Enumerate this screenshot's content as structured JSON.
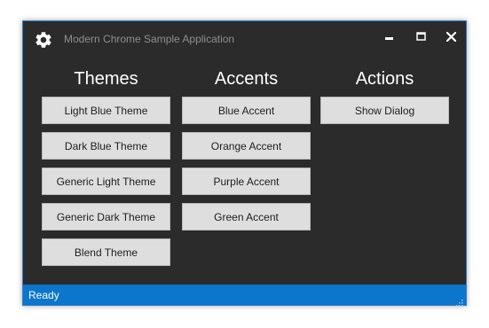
{
  "window": {
    "title": "Modern Chrome Sample Application",
    "icon": "gear-icon",
    "controls": {
      "minimize_icon": "minimize-icon",
      "maximize_icon": "maximize-icon",
      "close_icon": "close-icon"
    }
  },
  "themes": {
    "heading": "Themes",
    "buttons": [
      "Light Blue Theme",
      "Dark Blue Theme",
      "Generic Light Theme",
      "Generic Dark Theme",
      "Blend Theme"
    ]
  },
  "accents": {
    "heading": "Accents",
    "buttons": [
      "Blue Accent",
      "Orange Accent",
      "Purple Accent",
      "Green Accent"
    ]
  },
  "actions": {
    "heading": "Actions",
    "buttons": [
      "Show Dialog"
    ]
  },
  "statusbar": {
    "text": "Ready",
    "grip_icon": "resize-grip-icon"
  },
  "colors": {
    "window_bg": "#2b2b2b",
    "accent": "#0b76cc",
    "button_bg": "#dedede"
  }
}
